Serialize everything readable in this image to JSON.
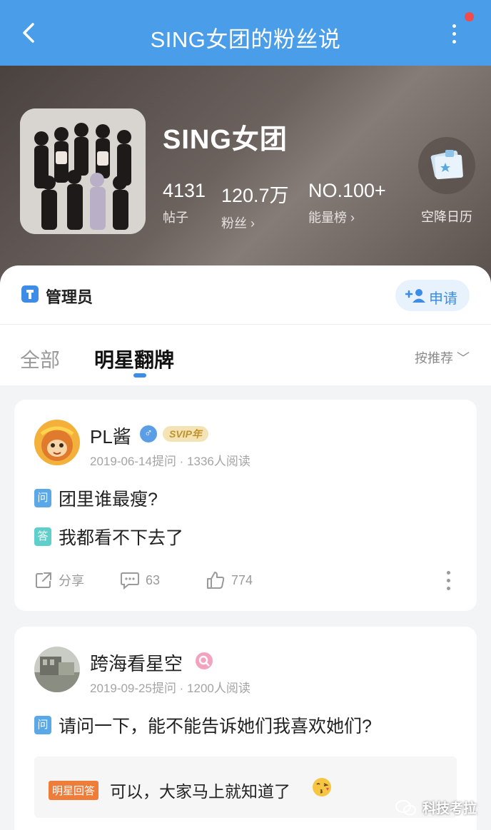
{
  "topbar": {
    "title": "SING女团的粉丝说"
  },
  "header": {
    "name": "SING女团",
    "stats": [
      {
        "value": "4131",
        "label": "帖子"
      },
      {
        "value": "120.7万",
        "label": "粉丝 ›"
      },
      {
        "value": "NO.100+",
        "label": "能量榜 ›"
      }
    ],
    "airdrop_label": "空降日历"
  },
  "admin": {
    "label": "管理员",
    "apply_label": "申请"
  },
  "tabs": {
    "all": "全部",
    "star": "明星翻牌",
    "sort": "按推荐 ﹀"
  },
  "posts": [
    {
      "username": "PL酱",
      "gender": "♂",
      "vip": "SVIP年",
      "meta": "2019-06-14提问 · 1336人阅读",
      "q_tag": "问",
      "question": "团里谁最瘦?",
      "a_tag": "答",
      "answer": "我都看不下去了",
      "share": "分享",
      "comments": "63",
      "likes": "774"
    },
    {
      "username": "跨海看星空",
      "meta": "2019-09-25提问 · 1200人阅读",
      "q_tag": "问",
      "question": "请问一下，能不能告诉她们我喜欢她们?",
      "star_tag": "明星回答",
      "star_answer": "可以，大家马上就知道了"
    }
  ],
  "watermark": "科技考拉",
  "colors": {
    "topbar": "#4a9de8",
    "accent": "#3d8ce8",
    "star_tag": "#ef7d3a",
    "answer_tag": "#5ecfcb"
  }
}
